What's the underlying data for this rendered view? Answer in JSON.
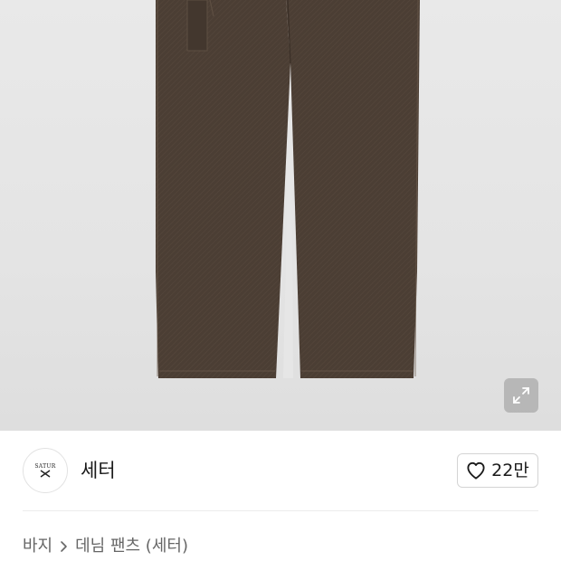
{
  "product_image": {
    "alt": "",
    "expand_icon": "expand-icon"
  },
  "seller": {
    "logo_text": "SATUR",
    "logo_icon": "crossed-swords-icon",
    "name": "세터"
  },
  "like": {
    "icon": "heart-outline-icon",
    "count": "22만"
  },
  "breadcrumb": {
    "items": [
      "바지",
      "데님 팬츠 (세터)"
    ],
    "separator_icon": "chevron-right-icon"
  },
  "colors": {
    "image_bg": "#e6e6e6",
    "pants": "#4a3d33",
    "text": "#1a1a1a",
    "muted_text": "#666666"
  }
}
